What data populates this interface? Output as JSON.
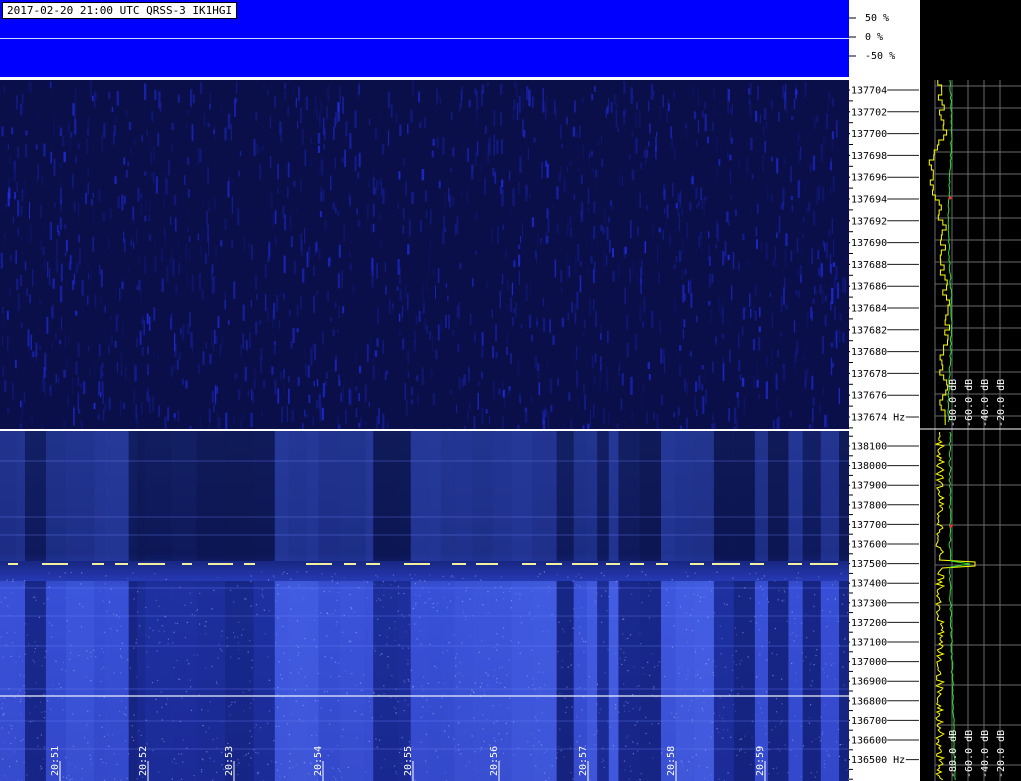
{
  "header": {
    "title": "2017-02-20 21:00 UTC QRSS-3 IK1HGI"
  },
  "amplitude_axis": {
    "labels": [
      "50 %",
      "0 %",
      "-50 %"
    ]
  },
  "upper_waterfall": {
    "freq_labels": [
      "137704",
      "137702",
      "137700",
      "137698",
      "137696",
      "137694",
      "137692",
      "137690",
      "137688",
      "137686",
      "137684",
      "137682",
      "137680",
      "137678",
      "137676",
      "137674 Hz"
    ]
  },
  "lower_waterfall": {
    "freq_labels": [
      "138100",
      "138000",
      "137900",
      "137800",
      "137700",
      "137600",
      "137500",
      "137400",
      "137300",
      "137200",
      "137100",
      "137000",
      "136900",
      "136800",
      "136700",
      "136600",
      "136500 Hz"
    ],
    "time_labels": [
      "20:51",
      "20:52",
      "20:53",
      "20:54",
      "20:55",
      "20:56",
      "20:57",
      "20:58",
      "20:59"
    ]
  },
  "spectrum_panel": {
    "db_labels": [
      "-80.0 dB",
      "-60.0 dB",
      "-40.0 dB",
      "-20.0 dB"
    ]
  },
  "colors": {
    "waterfall_base": "#0a0f4a",
    "amplitude_fill": "#0000ff",
    "trace_yellow": "#ffff00",
    "trace_green": "#33dd33"
  }
}
